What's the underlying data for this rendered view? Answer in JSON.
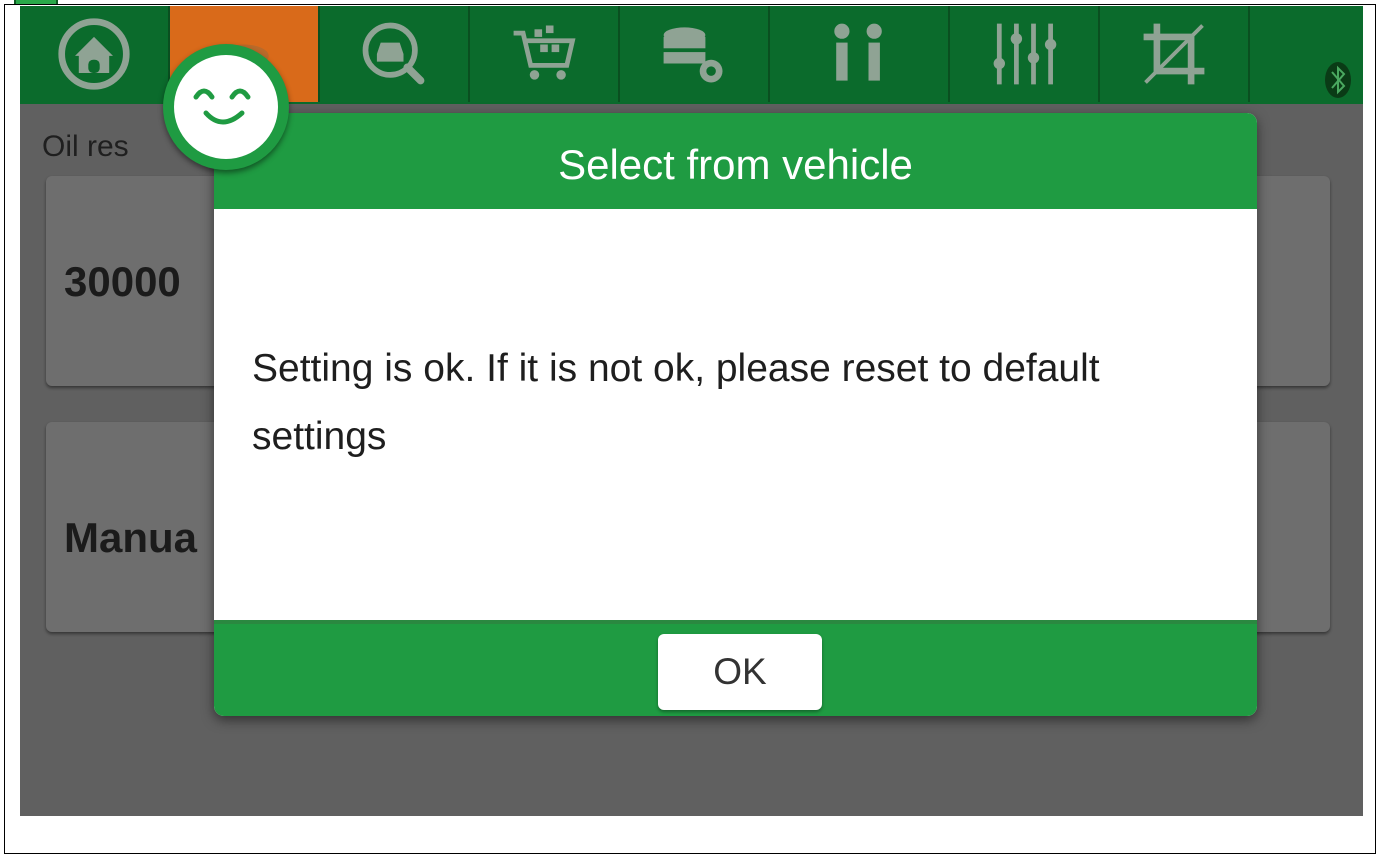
{
  "topbar": {
    "tabs": [
      {
        "name": "home-icon"
      },
      {
        "name": "car-fleet-icon",
        "active": true
      },
      {
        "name": "car-search-icon"
      },
      {
        "name": "shopping-cart-icon"
      },
      {
        "name": "database-settings-icon"
      },
      {
        "name": "people-icon"
      },
      {
        "name": "sliders-icon"
      },
      {
        "name": "crop-icon"
      }
    ],
    "status_icon": "bluetooth-icon"
  },
  "page": {
    "subtitle": "Oil res",
    "cards": [
      {
        "value": "30000"
      },
      {
        "value": "Manua"
      }
    ]
  },
  "dialog": {
    "title": "Select from vehicle",
    "message": "Setting is ok. If it is not ok, please reset to default settings",
    "ok_label": "OK"
  },
  "overlay": {
    "icon": "smiley-face-icon"
  },
  "colors": {
    "topbar_green": "#0b6b2c",
    "dialog_green": "#1f9b42",
    "active_tab_orange": "#d96a1a",
    "background_gray": "#606060"
  }
}
